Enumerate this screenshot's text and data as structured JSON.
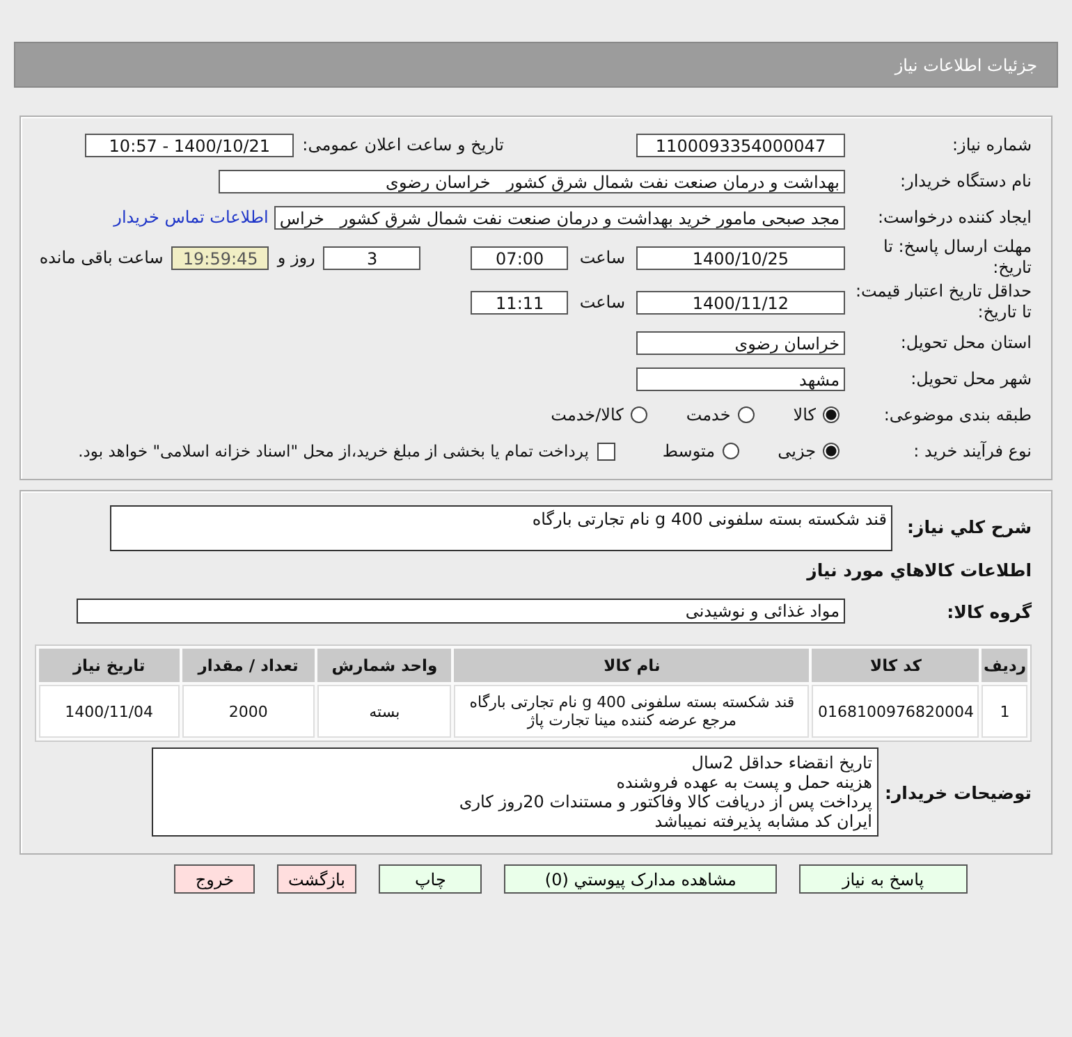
{
  "header": {
    "title": "جزئیات اطلاعات نیاز"
  },
  "details": {
    "need_number": {
      "label": "شماره نیاز:",
      "value": "1100093354000047"
    },
    "announce": {
      "label": "تاریخ و ساعت اعلان عمومی:",
      "value": "1400/10/21 - 10:57"
    },
    "buyer_org": {
      "label": "نام دستگاه خریدار:",
      "value": "بهداشت و درمان صنعت نفت شمال شرق کشور   خراسان رضوی"
    },
    "requester": {
      "label": "ایجاد کننده درخواست:",
      "value": "مجد صبحی مامور خرید بهداشت و درمان صنعت نفت شمال شرق کشور   خراس",
      "link": "اطلاعات تماس خریدار"
    },
    "deadline": {
      "label": "مهلت ارسال پاسخ: تا تاریخ:",
      "date": "1400/10/25",
      "time_label": "ساعت",
      "time": "07:00",
      "days": "3",
      "days_label": "روز و",
      "remaining": "19:59:45",
      "remaining_label": "ساعت باقی مانده"
    },
    "validity": {
      "label": "حداقل تاریخ اعتبار قیمت: تا تاریخ:",
      "date": "1400/11/12",
      "time_label": "ساعت",
      "time": "11:11"
    },
    "province": {
      "label": "استان محل تحویل:",
      "value": "خراسان رضوی"
    },
    "city": {
      "label": "شهر محل تحویل:",
      "value": "مشهد"
    },
    "category": {
      "label": "طبقه بندی موضوعی:",
      "options": [
        {
          "label": "کالا",
          "selected": true
        },
        {
          "label": "خدمت",
          "selected": false
        },
        {
          "label": "کالا/خدمت",
          "selected": false
        }
      ]
    },
    "process": {
      "label": "نوع فرآیند خرید :",
      "options": [
        {
          "label": "جزیی",
          "selected": true
        },
        {
          "label": "متوسط",
          "selected": false
        }
      ],
      "payment": {
        "checked": false,
        "text": "پرداخت تمام یا بخشی از مبلغ خرید،از محل \"اسناد خزانه اسلامی\" خواهد بود."
      }
    }
  },
  "summary": {
    "label": "شرح کلي نياز:",
    "value": "قند شکسته بسته سلفونی 400 g نام تجارتی بارگاه"
  },
  "goods_title": "اطلاعات کالاهاي مورد نياز",
  "group": {
    "label": "گروه کالا:",
    "value": "مواد غذائی و نوشیدنی"
  },
  "table": {
    "columns": [
      "ردیف",
      "کد کالا",
      "نام کالا",
      "واحد شمارش",
      "تعداد / مقدار",
      "تاریخ نیاز"
    ],
    "rows": [
      {
        "cells": [
          "1",
          "0168100976820004",
          "قند شکسته بسته سلفونی 400 g نام تجارتی بارگاه مرجع عرضه کننده مینا تجارت پاژ",
          "بسته",
          "2000",
          "1400/11/04"
        ]
      }
    ]
  },
  "notes": {
    "label": "توضیحات خریدار:",
    "lines": [
      "تاریخ انقضاء حداقل 2سال",
      "هزینه حمل و پست به عهده فروشنده",
      "پرداخت پس از دریافت کالا وفاکتور و مستندات 20روز کاری",
      "ایران کد مشابه پذیرفته نمیباشد"
    ]
  },
  "buttons": [
    {
      "label": "پاسخ به نیاز",
      "kind": "normal"
    },
    {
      "label": "مشاهده مدارک پیوستي (0)",
      "kind": "normal"
    },
    {
      "label": "چاپ",
      "kind": "normal"
    },
    {
      "label": "بازگشت",
      "kind": "danger"
    },
    {
      "label": "خروج",
      "kind": "danger"
    }
  ]
}
